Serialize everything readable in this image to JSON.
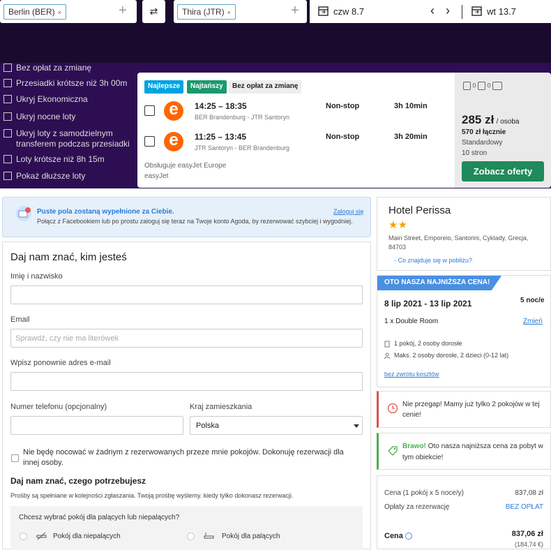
{
  "search": {
    "from": "Berlin (BER)",
    "to": "Thira (JTR)",
    "depart": "czw 8.7",
    "return": "wt 13.7",
    "remove_glyph": "×",
    "add_glyph": "+",
    "swap_glyph": "⇄",
    "prev_glyph": "‹",
    "next_glyph": "›"
  },
  "filters": [
    "Bez opłat za zmianę",
    "Przesiadki krótsze niż 3h 00m",
    "Ukryj Ekonomiczna",
    "Ukryj nocne loty",
    "Ukryj loty z samodzielnym transferem podczas przesiadki",
    "Loty krótsze niż 8h 15m",
    "Pokaż dłuższe loty"
  ],
  "result": {
    "badges": [
      "Najlepsze",
      "Najtańszy",
      "Bez opłat za zmianę"
    ],
    "flights": [
      {
        "time": "14:25 – 18:35",
        "route": "BER Brandenburg - JTR Santoryn",
        "stops": "Non-stop",
        "duration": "3h 10min"
      },
      {
        "time": "11:25 – 13:45",
        "route": "JTR Santoryn - BER Brandenburg",
        "stops": "Non-stop",
        "duration": "3h 20min"
      }
    ],
    "operated": "Obsługuje easyJet Europe",
    "airline": "easyJet",
    "logo_letter": "e",
    "bag_counts": [
      "0",
      "0"
    ],
    "price": "285 zł",
    "per_person": "/ osoba",
    "total": "570 zł łącznie",
    "class": "Standardowy",
    "sites": "10 stron",
    "cta": "Zobacz oferty"
  },
  "agoda": {
    "info_title": "Puste pola zostaną wypełnione za Ciebie.",
    "info_text": "Połącz z Facebookiem lub po prostu zaloguj się teraz na Twoje konto Agoda, by rezerwować szybciej i wygodniej.",
    "login": "Zaloguj się",
    "form_title": "Daj nam znać, kim jesteś",
    "name_label": "Imię i nazwisko",
    "email_label": "Email",
    "email_placeholder": "Sprawdź, czy nie ma literówek",
    "email2_label": "Wpisz ponownie adres e-mail",
    "phone_label": "Numer telefonu (opcjonalny)",
    "country_label": "Kraj zamieszkania",
    "country_value": "Polska",
    "no_stay": "Nie będę nocować w żadnym z rezerwowanych przeze mnie pokojów. Dokonuję rezerwacji dla innej osoby.",
    "needs_title": "Daj nam znać, czego potrzebujesz",
    "needs_text": "Prośby są spełniane w kolejności zgłaszania. Twoją prośbę wyślemy. kiedy tylko dokonasz rezerwacji.",
    "smoke_q": "Chcesz wybrać pokój dla palących lub niepalących?",
    "nonsmoking": "Pokój dla niepalących",
    "smoking": "Pokój dla palących"
  },
  "hotel": {
    "name": "Hotel Perissa",
    "stars": "★★",
    "address": "Main Street, Emporeio, Santorini, Cyklady, Grecja, 84703",
    "nearby": "- Co znajduje się w pobliżu?"
  },
  "booking": {
    "ribbon": "OTO NASZA NAJNIŻSZA CENA!",
    "dates": "8 lip 2021 - 13 lip 2021",
    "nights": "5 noc/e",
    "room": "1 x Double Room",
    "change": "Zmień",
    "occupancy": "1 pokój, 2 osoby dorosłe",
    "max": "Maks. 2 osoby dorosłe, 2 dzieci (0-12 lat)",
    "refund": "bez zwrotu kosztów"
  },
  "alerts": {
    "urgent": "Nie przegap! Mamy już tylko 2 pokojów w tej cenie!",
    "bravo": "Brawo!",
    "lowest": " Oto nasza najniższa cena za pobyt w tym obiekcie!"
  },
  "cost": {
    "line1_label": "Cena (1 pokój x 5 noce/y)",
    "line1_value": "837,08 zł",
    "fee_label": "Opłaty za rezerwację",
    "fee_value": "BEZ OPŁAT",
    "total_label": "Cena",
    "total_value": "837,06 zł",
    "total_eur": "(184,74 €)"
  }
}
